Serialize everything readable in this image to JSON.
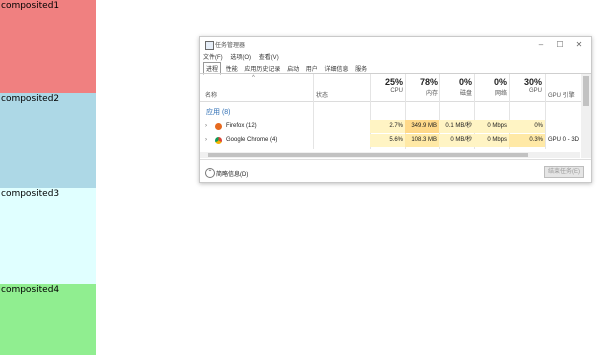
{
  "panels": [
    {
      "label": "composited1",
      "color": "#f08080"
    },
    {
      "label": "composited2",
      "color": "#add8e6"
    },
    {
      "label": "composited3",
      "color": "#e0ffff"
    },
    {
      "label": "composited4",
      "color": "#90ee90"
    }
  ],
  "window": {
    "title": "任务管理器",
    "controls": {
      "minimize": "–",
      "maximize": "☐",
      "close": "✕"
    },
    "menu": [
      "文件(F)",
      "选项(O)",
      "查看(V)"
    ],
    "tabs": [
      "进程",
      "性能",
      "应用历史记录",
      "启动",
      "用户",
      "详细信息",
      "服务"
    ],
    "active_tab": 0,
    "columns": {
      "sort_indicator": "^",
      "name": "名称",
      "status": "状态",
      "metrics": [
        {
          "pct": "25%",
          "name": "CPU"
        },
        {
          "pct": "78%",
          "name": "内存"
        },
        {
          "pct": "0%",
          "name": "磁盘"
        },
        {
          "pct": "0%",
          "name": "网络"
        },
        {
          "pct": "30%",
          "name": "GPU"
        }
      ],
      "gpu_engine": "GPU 引擎"
    },
    "group_label": "应用 (8)",
    "rows": [
      {
        "expander": "›",
        "name": "Firefox (12)",
        "icon_color": "#e66a1f",
        "cpu": "2.7%",
        "memory": "349.9 MB",
        "disk": "0.1 MB/秒",
        "network": "0 Mbps",
        "gpu": "0%",
        "gpu_engine": ""
      },
      {
        "expander": "›",
        "name": "Google Chrome (4)",
        "icon_color": "#db4437",
        "cpu": "5.6%",
        "memory": "108.3 MB",
        "disk": "0 MB/秒",
        "network": "0 Mbps",
        "gpu": "0.3%",
        "gpu_engine": "GPU 0 - 3D"
      }
    ],
    "footer": {
      "less_icon": "⌃",
      "less_label": "简略信息(D)",
      "end_task": "结束任务(E)"
    }
  }
}
